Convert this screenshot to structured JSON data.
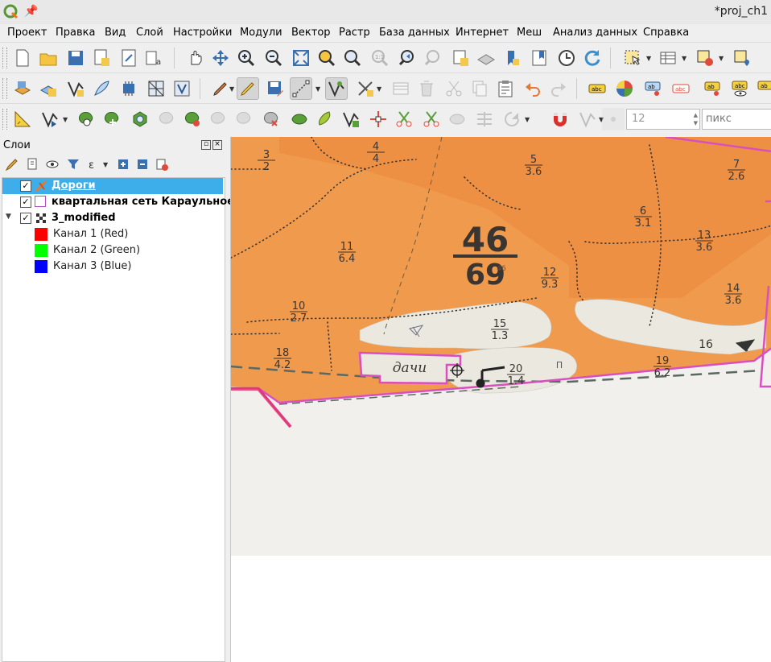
{
  "window": {
    "title": "*proj_ch1"
  },
  "menu": [
    "Проект",
    "Правка",
    "Вид",
    "Слой",
    "Настройки",
    "Модули",
    "Вектор",
    "Растр",
    "База данных",
    "Интернет",
    "Меш",
    "Анализ данных",
    "Справка"
  ],
  "digitize_toolbar": {
    "size_value": "12",
    "unit_value": "пикс"
  },
  "layers_panel": {
    "title": "Слои",
    "layers": [
      {
        "label": "Дороги",
        "checked": true,
        "selected": true
      },
      {
        "label": "квартальная сеть Караульное",
        "checked": true
      },
      {
        "label": "3_modified",
        "checked": true
      },
      {
        "label": "Канал 1 (Red)",
        "color": "#ff0000"
      },
      {
        "label": "Канал 2 (Green)",
        "color": "#00ff00"
      },
      {
        "label": "Канал 3 (Blue)",
        "color": "#0000ff"
      }
    ]
  },
  "map": {
    "quarter_number": "46",
    "quarter_area": "69",
    "small_mark": "46",
    "place_label": "дачи",
    "road_mark": "П",
    "parcels": [
      {
        "num": "3",
        "area": "2"
      },
      {
        "num": "4",
        "area": "4"
      },
      {
        "num": "5",
        "area": "3.6"
      },
      {
        "num": "7",
        "area": "2.6"
      },
      {
        "num": "6",
        "area": "3.1"
      },
      {
        "num": "13",
        "area": "3.6"
      },
      {
        "num": "11",
        "area": "6.4"
      },
      {
        "num": "12",
        "area": "9.3"
      },
      {
        "num": "14",
        "area": "3.6"
      },
      {
        "num": "10",
        "area": "2.7"
      },
      {
        "num": "15",
        "area": "1.3"
      },
      {
        "num": "18",
        "area": "4.2"
      },
      {
        "num": "20",
        "area": "1.4"
      },
      {
        "num": "19",
        "area": "6.2"
      }
    ],
    "lone_number": "16",
    "colors": {
      "forest": "#f09a4e",
      "forest_dark": "#ec8a3e",
      "clearing": "#ebe8e0",
      "boundary": "#d94fc0",
      "paper": "#f2f0ec"
    }
  }
}
